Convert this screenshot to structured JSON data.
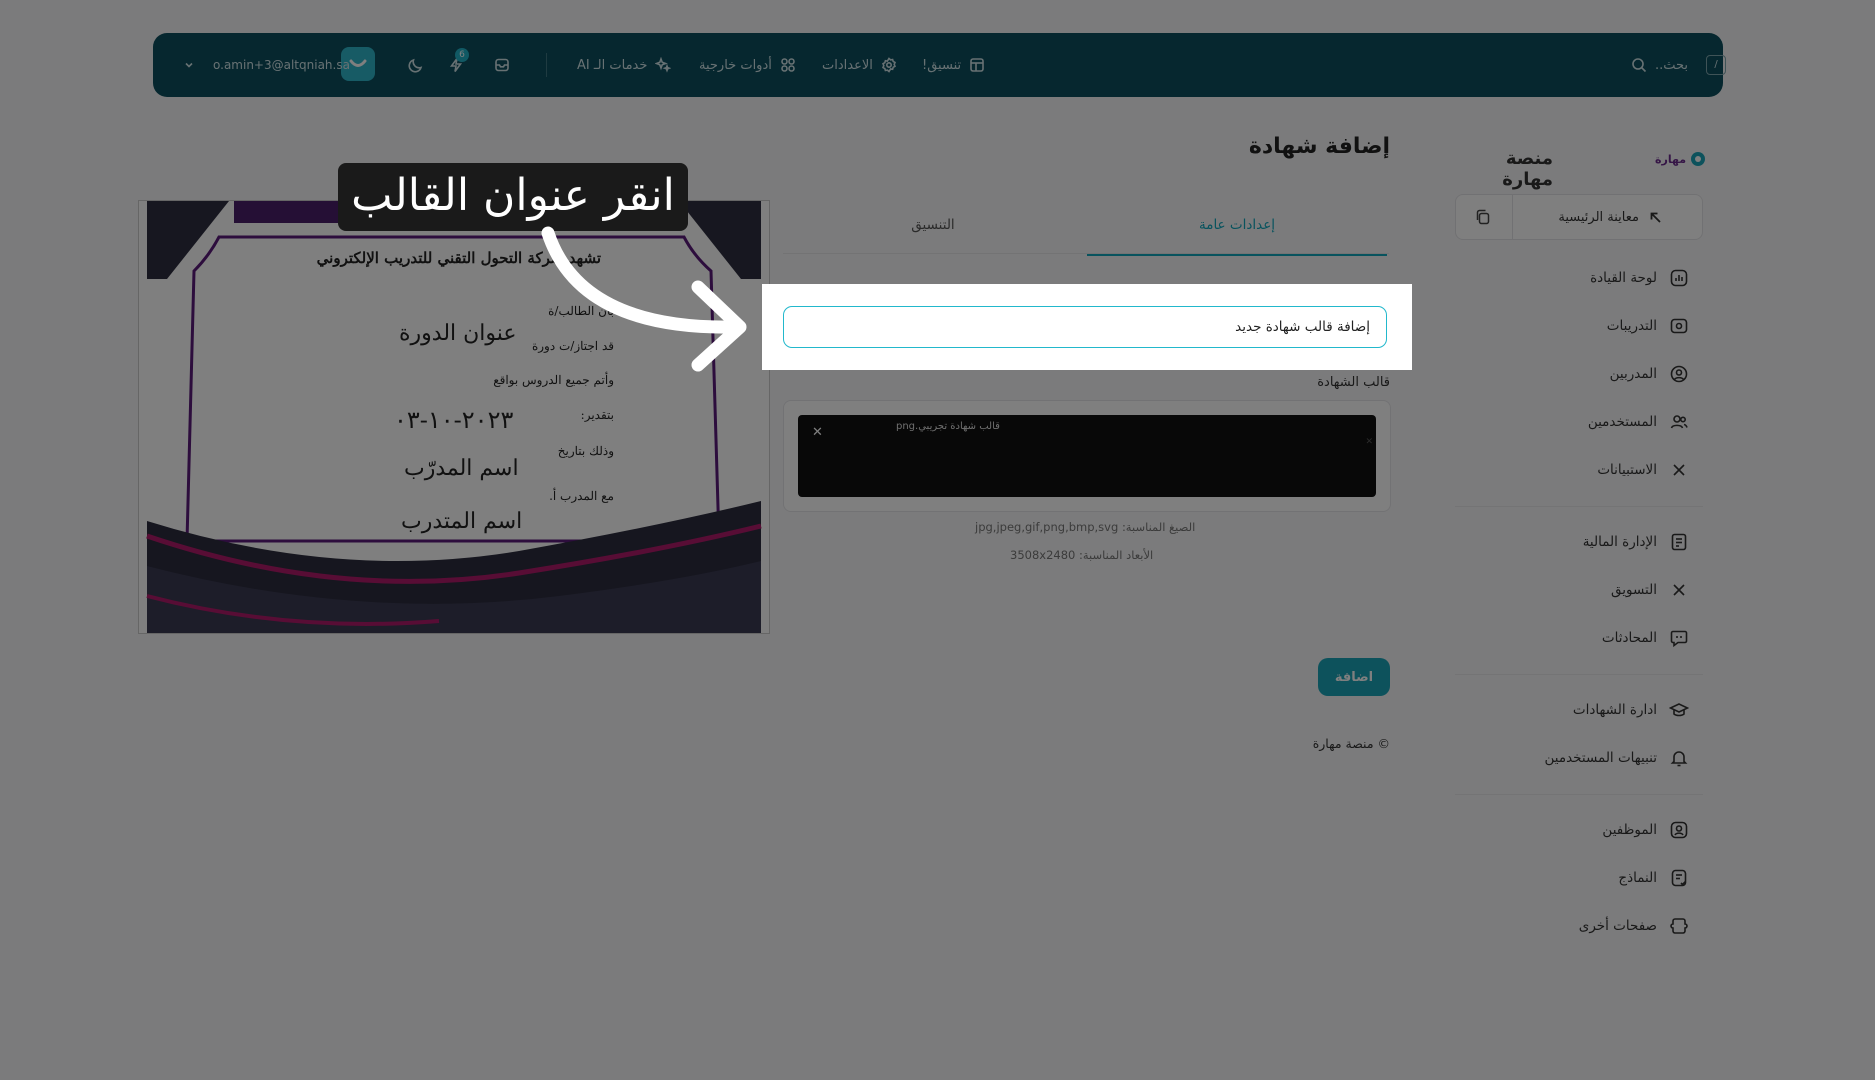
{
  "topbar": {
    "search_label": "بحث..",
    "search_shortcut": "/",
    "nav": [
      {
        "label": "تنسيق!",
        "icon": "layout-icon"
      },
      {
        "label": "الاعدادات",
        "icon": "gear-icon"
      },
      {
        "label": "أدوات خارجية",
        "icon": "grid-icon"
      },
      {
        "label": "خدمات الـ AI",
        "icon": "sparkles-icon"
      }
    ],
    "notification_count": "6",
    "user_email": "o.amin+3@altqniah.sa"
  },
  "sidebar": {
    "brand_name": "منصة مهارة",
    "logo_text": "مهارة",
    "preview_link": "معاينة الرئيسية",
    "groups": [
      [
        {
          "label": "لوحة القيادة",
          "icon": "dashboard-icon"
        },
        {
          "label": "التدريبات",
          "icon": "training-icon"
        },
        {
          "label": "المدربين",
          "icon": "user-circle-icon"
        },
        {
          "label": "المستخدمين",
          "icon": "users-icon"
        },
        {
          "label": "الاستبيانات",
          "icon": "close-icon"
        }
      ],
      [
        {
          "label": "الإدارة المالية",
          "icon": "finance-icon"
        },
        {
          "label": "التسويق",
          "icon": "close-icon"
        },
        {
          "label": "المحادثات",
          "icon": "chat-icon"
        }
      ],
      [
        {
          "label": "ادارة الشهادات",
          "icon": "graduation-cap-icon"
        },
        {
          "label": "تنبيهات المستخدمين",
          "icon": "bell-icon"
        }
      ],
      [
        {
          "label": "الموظفين",
          "icon": "employee-icon"
        },
        {
          "label": "النماذج",
          "icon": "form-icon"
        },
        {
          "label": "صفحات أخرى",
          "icon": "pages-icon"
        }
      ]
    ]
  },
  "main": {
    "page_title": "إضافة شهادة",
    "tabs": [
      {
        "label": "إعدادات عامة",
        "active": true
      },
      {
        "label": "التنسيق",
        "active": false
      }
    ],
    "template_title_value": "إضافة قالب شهادة جديد",
    "certificate_template_label": "قالب الشهادة",
    "uploaded_file_name": "قالب شهادة تجريبي.png",
    "formats_hint_label": "الصيغ المناسبة:",
    "formats_hint_value": "jpg,jpeg,gif,png,bmp,svg",
    "dimensions_hint_label": "الأبعاد المناسبة:",
    "dimensions_hint_value": "3508x2480",
    "add_button": "اضافة",
    "footer": "© منصة مهارة"
  },
  "certificate_preview": {
    "heading": "تشهد شركة التحول التقني للتدريب الإلكتروني",
    "line_student": "بأن الطالب/ة",
    "course_title": "عنوان الدورة",
    "line_passed": "قد اجتاز/ت دورة",
    "line_lessons": "وأتم جميع الدروس بواقع",
    "line_grade": "بتقدير:",
    "date": "٢٠٢٣-١٠-٠٣",
    "line_date": "وذلك بتاريخ",
    "trainer_name": "اسم المدرّب",
    "line_trainer": "مع المدرب أ.",
    "trainee_name": "اسم المتدرب"
  },
  "tooltip": {
    "text": "انقر عنوان القالب"
  },
  "colors": {
    "topbar": "#0c4f5e",
    "accent": "#1aa4b8",
    "cert_purple": "#5b1a7a",
    "cert_magenta": "#b01a6a"
  }
}
